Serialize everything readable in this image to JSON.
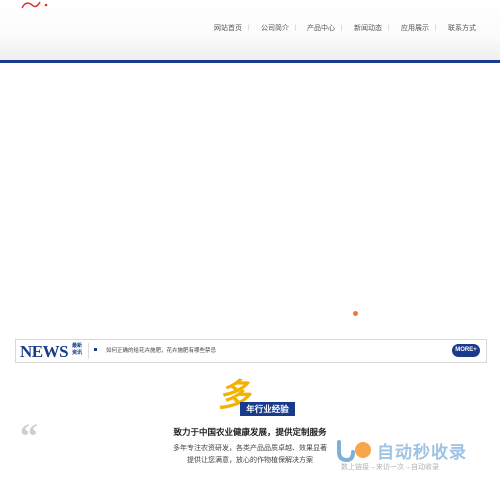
{
  "header": {
    "nav": [
      {
        "label": "网站首页"
      },
      {
        "label": "公司简介"
      },
      {
        "label": "产品中心"
      },
      {
        "label": "新闻动态"
      },
      {
        "label": "应用展示"
      },
      {
        "label": "联系方式"
      }
    ]
  },
  "news": {
    "title": "NEWS",
    "subtitle_line1": "最新",
    "subtitle_line2": "资讯",
    "item": "如何正确的给花卉施肥，花卉施肥有哪些禁忌",
    "more_label": "MORE+"
  },
  "intro": {
    "big_char": "多",
    "experience": "年行业经验",
    "slogan": "致力于中国农业健康发展，提供定制服务",
    "description_line1": "多年专注农资研发，各类产品品质卓越、效果显著",
    "description_line2": "提供让您满意，放心的作物植保解决方案",
    "quote_mark": "“"
  },
  "watermark": {
    "title": "自动秒收录",
    "subtitle": "数上链接→来访一次→自动收录"
  },
  "colors": {
    "brand_blue": "#1a3a8c",
    "accent_yellow": "#f2b200",
    "dot_orange": "#f07a2c"
  }
}
